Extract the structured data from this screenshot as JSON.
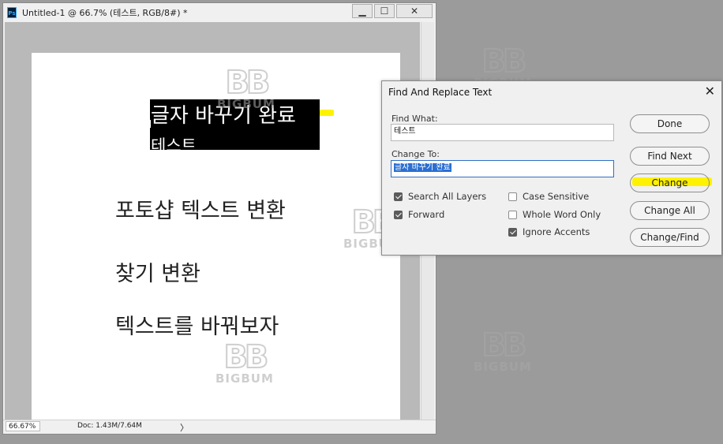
{
  "document_window": {
    "title": "Untitled-1 @ 66.7% (테스트, RGB/8#) *",
    "app_icon": "Ps",
    "minimize_symbol": "▁",
    "restore_symbol": "☐",
    "close_symbol": "✕",
    "zoom": "66.67%",
    "doc_info": "Doc: 1.43M/7.64M",
    "status_arrow": "〉"
  },
  "canvas_text": {
    "selected_line1": "글자 바꾸기 완료",
    "selected_line2": "테스트",
    "line3": "포토샵 텍스트 변환",
    "line4": "찾기 변환",
    "line5": "텍스트를 바꿔보자"
  },
  "watermark": {
    "logo": "BB",
    "text": "BIGBUM"
  },
  "dialog": {
    "title": "Find And Replace Text",
    "close_symbol": "✕",
    "find_label": "Find What:",
    "find_value": "테스트",
    "change_label": "Change To:",
    "change_value": "글자 바꾸기 완료",
    "options": {
      "search_all_layers": "Search All Layers",
      "forward": "Forward",
      "case_sensitive": "Case Sensitive",
      "whole_word_only": "Whole Word Only",
      "ignore_accents": "Ignore Accents"
    },
    "buttons": {
      "done": "Done",
      "find_next": "Find Next",
      "change": "Change",
      "change_all": "Change All",
      "change_find": "Change/Find"
    },
    "highlight_color": "#fff200"
  }
}
